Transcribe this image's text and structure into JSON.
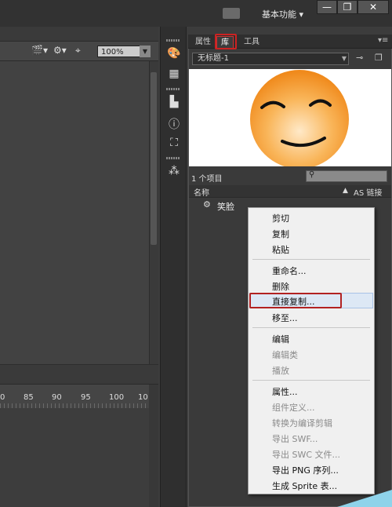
{
  "window": {
    "workspace_label": "基本功能",
    "workspace_arrow": "▾",
    "minimize": "—",
    "restore": "❐",
    "close": "✕"
  },
  "doc_toolbar": {
    "zoom_value": "100%"
  },
  "timeline": {
    "ruler_numbers": [
      "0",
      "85",
      "90",
      "95",
      "100",
      "10"
    ]
  },
  "panel": {
    "tabs": [
      "属性",
      "库",
      "工具"
    ],
    "active_tab": "库",
    "document_select": "无标题-1",
    "item_count": "1 个项目",
    "col_name": "名称",
    "col_linkage": "AS 链接",
    "item_name": "笑脸"
  },
  "context_menu": {
    "items": [
      {
        "label": "剪切",
        "enabled": true
      },
      {
        "label": "复制",
        "enabled": true
      },
      {
        "label": "粘贴",
        "enabled": true
      },
      {
        "label": "重命名...",
        "enabled": true
      },
      {
        "label": "删除",
        "enabled": true
      },
      {
        "label": "直接复制...",
        "enabled": true,
        "highlighted": true
      },
      {
        "label": "移至...",
        "enabled": true
      },
      {
        "label": "编辑",
        "enabled": true
      },
      {
        "label": "编辑类",
        "enabled": false
      },
      {
        "label": "播放",
        "enabled": false
      },
      {
        "label": "属性...",
        "enabled": true
      },
      {
        "label": "组件定义...",
        "enabled": false
      },
      {
        "label": "转换为编译剪辑",
        "enabled": false
      },
      {
        "label": "导出 SWF...",
        "enabled": false
      },
      {
        "label": "导出 SWC 文件...",
        "enabled": false
      },
      {
        "label": "导出 PNG 序列...",
        "enabled": true
      },
      {
        "label": "生成 Sprite 表...",
        "enabled": true
      }
    ]
  },
  "colors": {
    "highlight_box": "#b22222",
    "panel_bg": "#3a3a3a",
    "menu_bg": "#f0f0f0"
  }
}
